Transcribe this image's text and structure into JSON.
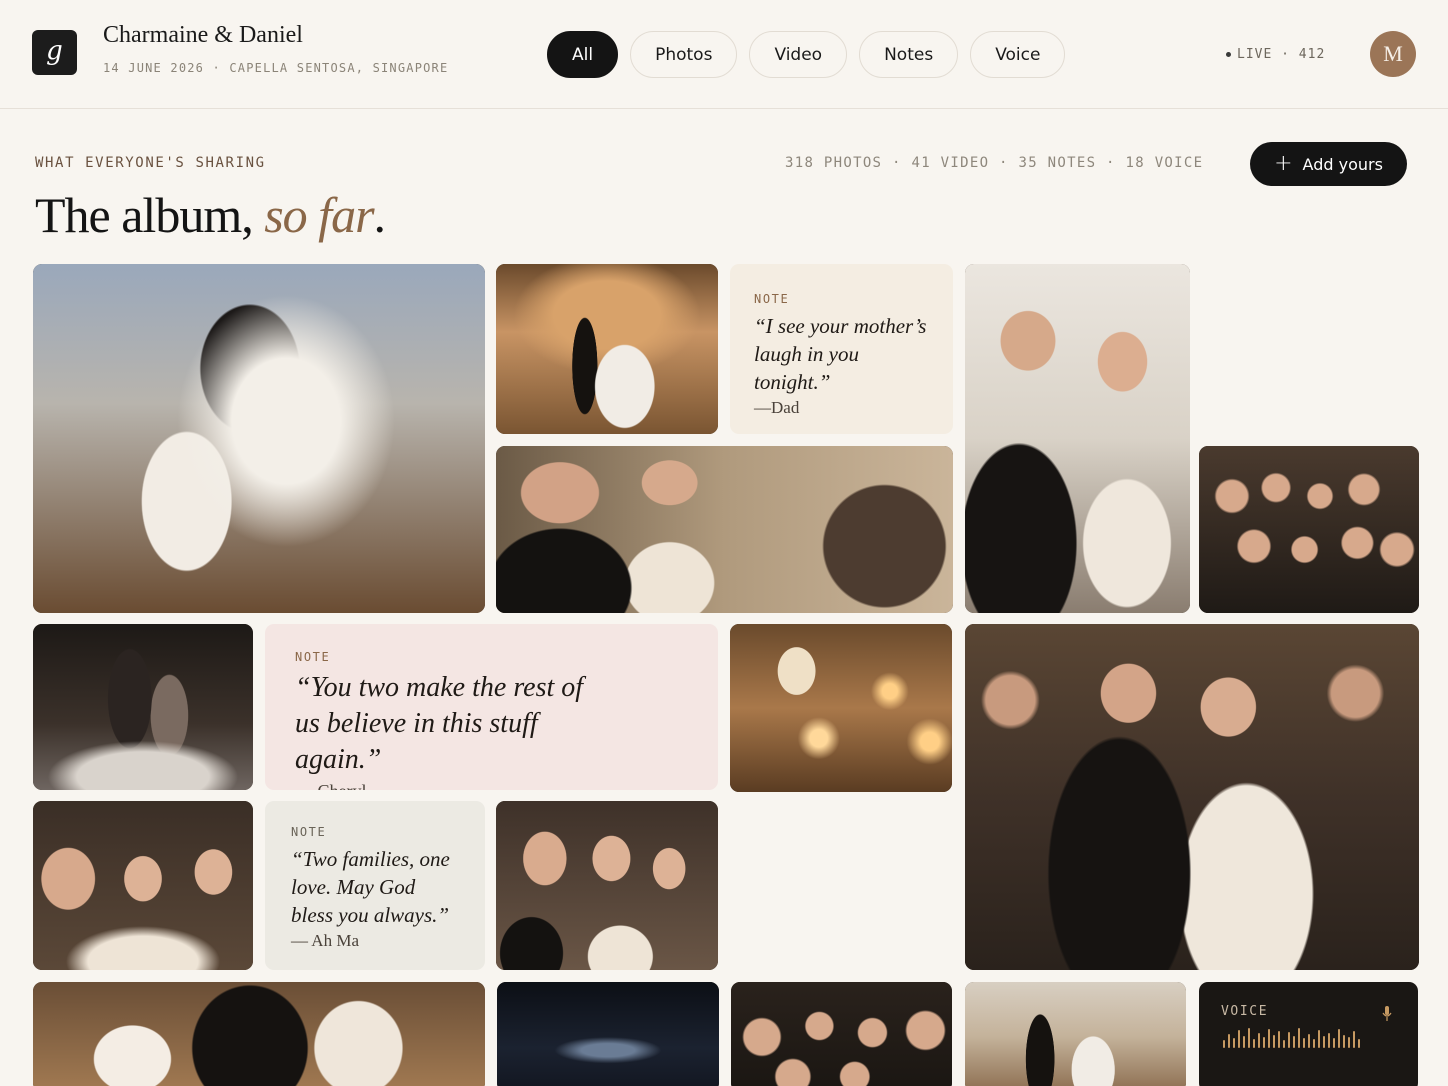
{
  "app": {
    "logo_letter": "g"
  },
  "event": {
    "couple": "Charmaine & Daniel",
    "meta": "14 JUNE 2026 · CAPELLA SENTOSA, SINGAPORE"
  },
  "filters": [
    {
      "label": "All",
      "active": true
    },
    {
      "label": "Photos",
      "active": false
    },
    {
      "label": "Video",
      "active": false
    },
    {
      "label": "Notes",
      "active": false
    },
    {
      "label": "Voice",
      "active": false
    }
  ],
  "live": {
    "label": "LIVE · 412"
  },
  "user": {
    "initial": "M"
  },
  "section": {
    "label": "WHAT EVERYONE'S SHARING",
    "counts": "318 PHOTOS · 41 VIDEO · 35 NOTES · 18 VOICE",
    "add_label": "Add yours",
    "headline_main": "The album,",
    "headline_accent": "so far",
    "headline_end": "."
  },
  "notes": [
    {
      "tag": "NOTE",
      "quote": "“I see your mother’s laugh in you tonight.”",
      "author": "—Dad"
    },
    {
      "tag": "NOTE",
      "quote": "“You two make the rest of us believe in this stuff again.”",
      "author": "— Cheryl"
    },
    {
      "tag": "NOTE",
      "quote": "“Two families, one love. May God bless you always.”",
      "author": "— Ah Ma"
    }
  ],
  "voice": {
    "tag": "VOICE",
    "icon": "microphone-icon"
  },
  "photos": [
    {
      "name": "photo-cake-cutting",
      "scene": "cake"
    },
    {
      "name": "photo-couple-stage",
      "scene": "stage"
    },
    {
      "name": "photo-couple-portrait",
      "scene": "portrait"
    },
    {
      "name": "photo-speech",
      "scene": "speech"
    },
    {
      "name": "photo-guests-group",
      "scene": "crowd"
    },
    {
      "name": "photo-first-dance",
      "scene": "dance"
    },
    {
      "name": "photo-table-candles",
      "scene": "candles"
    },
    {
      "name": "photo-couple-entrance",
      "scene": "entrance"
    },
    {
      "name": "photo-selfie-bridesmaids",
      "scene": "selfie"
    },
    {
      "name": "photo-selfie-couple",
      "scene": "selfie2"
    },
    {
      "name": "photo-cake-closeup",
      "scene": "cake2"
    },
    {
      "name": "photo-marina-night",
      "scene": "night"
    },
    {
      "name": "photo-guests-night",
      "scene": "crowd2"
    },
    {
      "name": "photo-couple-stage-2",
      "scene": "stage2"
    }
  ],
  "colors": {
    "accent": "#8a6748",
    "dark": "#141414",
    "note_cream": "#f4ede2",
    "note_pink": "#f4e6e3",
    "note_sage": "#eceae3"
  }
}
